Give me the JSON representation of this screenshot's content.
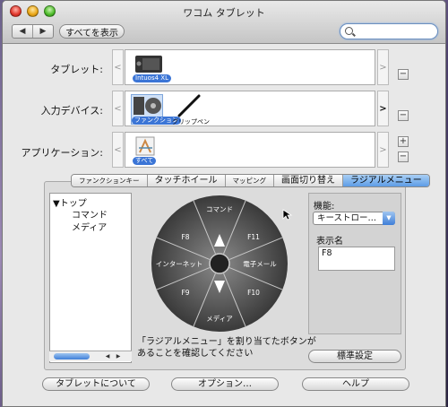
{
  "window": {
    "title": "ワコム タブレット"
  },
  "toolbar": {
    "back_label": "◀",
    "forward_label": "▶",
    "show_all_label": "すべてを表示",
    "search_placeholder": ""
  },
  "rows": {
    "tablet": {
      "label": "タブレット:",
      "item": "Intuos4 XL"
    },
    "input": {
      "label": "入力デバイス:",
      "items": [
        "ファンクション",
        "グリップペン"
      ]
    },
    "app": {
      "label": "アプリケーション:",
      "item": "すべて"
    }
  },
  "controls": {
    "left_arrow": "<",
    "right_arrow": ">",
    "minus": "−",
    "plus": "+"
  },
  "tabs": [
    "ファンクションキー",
    "タッチホイール",
    "マッピング",
    "画面切り替え",
    "ラジアルメニュー"
  ],
  "tree": {
    "root": "▼トップ",
    "children": [
      "コマンド",
      "メディア"
    ]
  },
  "wheel": {
    "segments": [
      "コマンド",
      "F11",
      "電子メール",
      "F10",
      "メディア",
      "F9",
      "インターネット",
      "F8"
    ]
  },
  "function": {
    "label": "機能:",
    "selected": "キーストロー…",
    "name_label": "表示名",
    "name_value": "F8"
  },
  "note": "「ラジアルメニュー」を割り当てたボタンがあることを確認してください",
  "buttons": {
    "default": "標準設定",
    "about": "タブレットについて",
    "options": "オプション…",
    "help": "ヘルプ"
  },
  "colors": {
    "accent": "#3b75d6",
    "tab_selected": "#5d9ce6"
  }
}
